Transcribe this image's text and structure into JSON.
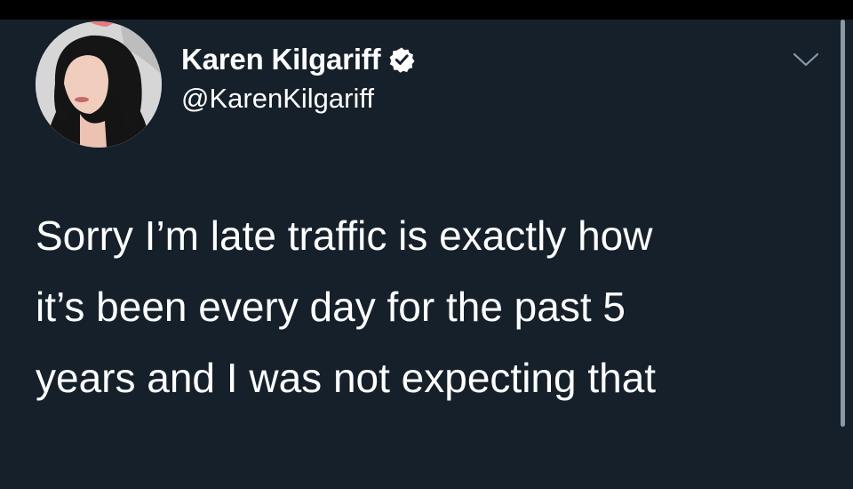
{
  "tweet": {
    "author": {
      "display_name": "Karen Kilgariff",
      "handle": "@KarenKilgariff",
      "verified": true
    },
    "text_lines": [
      "Sorry I’m late traffic is exactly how",
      "it’s been every day for the past 5",
      "years and I was not expecting that"
    ]
  },
  "icons": {
    "verified": "verified-badge-icon",
    "menu": "chevron-down-icon"
  },
  "colors": {
    "background": "#15202b",
    "text": "#ffffff",
    "verified_badge": "#ffffff"
  }
}
